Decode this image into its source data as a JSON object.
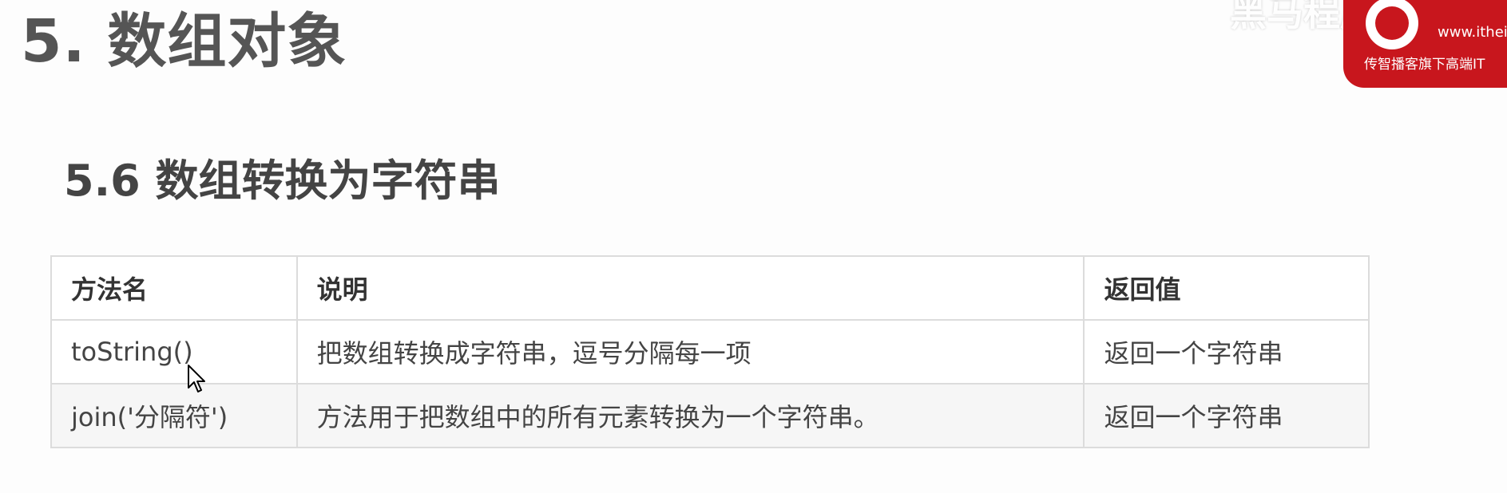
{
  "page": {
    "title": "5. 数组对象",
    "section_title": "5.6 数组转换为字符串"
  },
  "logo": {
    "url": "www.itheima",
    "slogan": "传智播客旗下高端IT",
    "watermark": "黑马程序员",
    "brand_color": "#c8161d"
  },
  "table": {
    "headers": [
      "方法名",
      "说明",
      "返回值"
    ],
    "rows": [
      [
        "toString()",
        "把数组转换成字符串，逗号分隔每一项",
        "返回一个字符串"
      ],
      [
        "join('分隔符')",
        "方法用于把数组中的所有元素转换为一个字符串。",
        "返回一个字符串"
      ]
    ]
  },
  "cursor": {
    "icon": "arrow-cursor-icon"
  }
}
